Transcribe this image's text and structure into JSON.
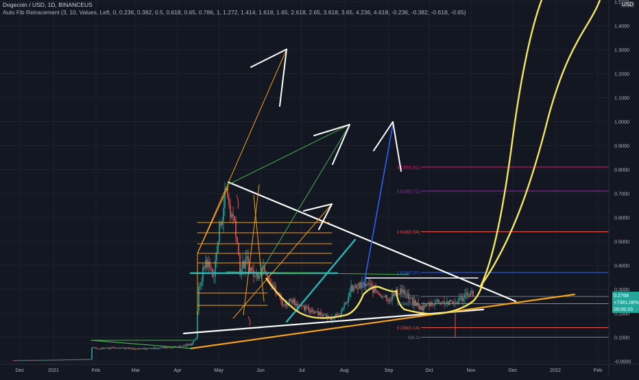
{
  "header": {
    "symbol_line": "Dogecoin / USD, 1D, BINANCEUS",
    "indicator_line": "Auto Fib Retracement (3, 10, Values, Left, 0, 0.236, 0.382, 0.5, 0.618, 0.65, 0.786, 1, 1.272, 1.414, 1.618, 1.65, 2.618, 2.65, 3.618, 3.65, 4.236, 4.618, -0.236, -0.382, -0.618, -0.65)"
  },
  "price_axis": {
    "currency": "USD",
    "ticks": [
      "1.5000",
      "1.4000",
      "1.3000",
      "1.2000",
      "1.1000",
      "1.0000",
      "0.9000",
      "0.8000",
      "0.7000",
      "0.6000",
      "0.5000",
      "0.4000",
      "0.3000",
      "0.2000",
      "0.1000",
      "-0.0000"
    ]
  },
  "time_axis": {
    "labels": [
      "Dec",
      "2021",
      "Feb",
      "Mar",
      "Apr",
      "May",
      "Jun",
      "Jul",
      "Aug",
      "Sep",
      "Oct",
      "Nov",
      "Dec",
      "2022",
      "Feb"
    ]
  },
  "price_tags": {
    "last_price": "0.2768",
    "change": "+7381.08%",
    "countdown": "05:06:33"
  },
  "colors": {
    "background": "#131722",
    "up": "#26a69a",
    "down": "#ef5350",
    "projection": "#f5e663",
    "trendline": "#ffffff",
    "support": "#f7a21b"
  },
  "chart_data": {
    "type": "candlestick",
    "title": "Dogecoin / USD, 1D, BINANCEUS",
    "ylim": [
      -0.02,
      1.5
    ],
    "x_axis": [
      "Dec",
      "2021",
      "Feb",
      "Mar",
      "Apr",
      "May",
      "Jun",
      "Jul",
      "Aug",
      "Sep",
      "Oct",
      "Nov",
      "Dec",
      "2022",
      "Feb"
    ],
    "approx_price_path": [
      [
        "Dec",
        0.003
      ],
      [
        "2021",
        0.005
      ],
      [
        "Feb",
        0.05
      ],
      [
        "Mar",
        0.055
      ],
      [
        "Apr",
        0.06
      ],
      [
        "Apr",
        0.35
      ],
      [
        "May",
        0.7
      ],
      [
        "May",
        0.4
      ],
      [
        "Jun",
        0.3
      ],
      [
        "Jul",
        0.2
      ],
      [
        "Aug",
        0.27
      ],
      [
        "Sep",
        0.28
      ],
      [
        "Oct",
        0.22
      ],
      [
        "Nov",
        0.2768
      ]
    ],
    "fib_levels": [
      {
        "label": "4.236(0.81)",
        "value": 0.81,
        "color": "#e91e63"
      },
      {
        "label": "3.618(0.71)",
        "value": 0.71,
        "color": "#9c27b0"
      },
      {
        "label": "2.618(0.54)",
        "value": 0.54,
        "color": "#ef5350"
      },
      {
        "label": "1.618(0.37)",
        "value": 0.37,
        "color": "#2962ff"
      },
      {
        "label": "1(0.27)",
        "value": 0.27,
        "color": "#787b86"
      },
      {
        "label": "0.786(0.24)",
        "value": 0.24,
        "color": "#2bb5b9"
      },
      {
        "label": "0.236(0.14)",
        "value": 0.14,
        "color": "#ef5350"
      },
      {
        "label": "0(0.1)",
        "value": 0.1,
        "color": "#787b86"
      }
    ],
    "last_price": 0.2768,
    "change_pct": 7381.08
  }
}
